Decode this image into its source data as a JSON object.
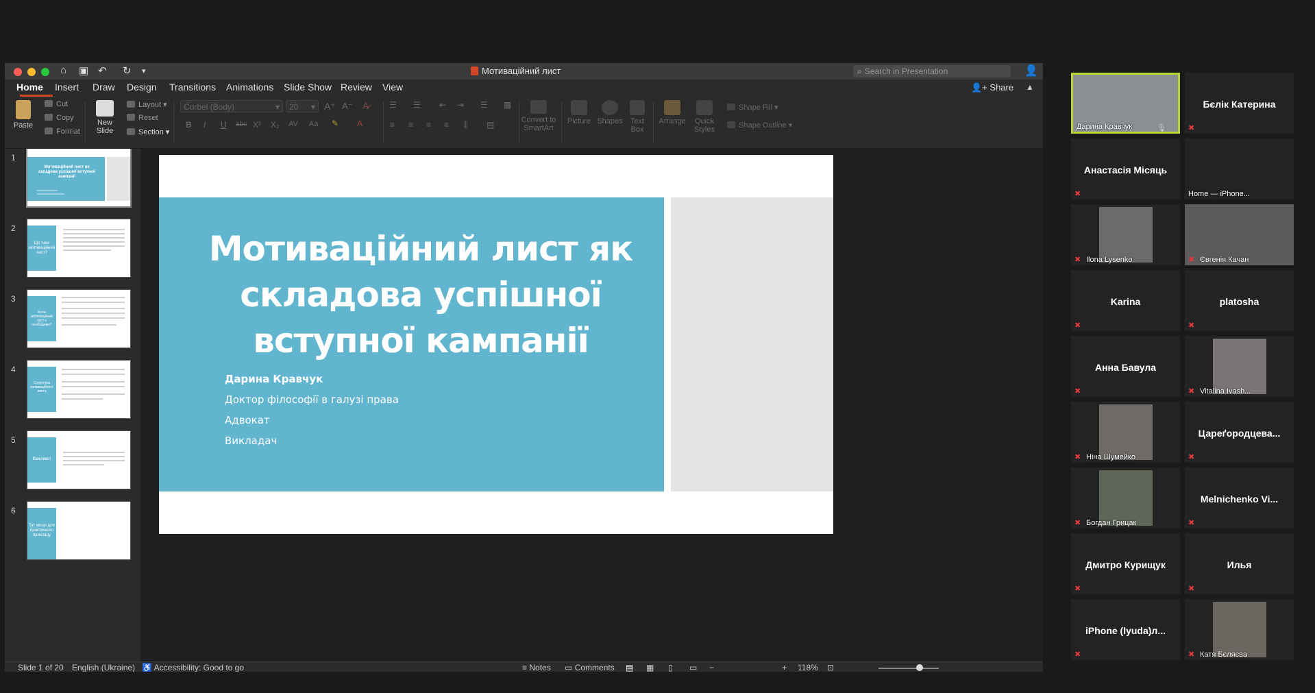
{
  "window": {
    "title": "Мотиваційний лист",
    "search_placeholder": "Search in Presentation",
    "share_label": "Share"
  },
  "tabs": [
    "Home",
    "Insert",
    "Draw",
    "Design",
    "Transitions",
    "Animations",
    "Slide Show",
    "Review",
    "View"
  ],
  "ribbon": {
    "paste": "Paste",
    "cut": "Cut",
    "copy": "Copy",
    "format": "Format",
    "new_slide": "New Slide",
    "layout": "Layout",
    "reset": "Reset",
    "section": "Section",
    "font_name": "Corbel (Body)",
    "font_size": "20",
    "convert_smartart": "Convert to SmartArt",
    "picture": "Picture",
    "shapes": "Shapes",
    "text_box": "Text Box",
    "arrange": "Arrange",
    "quick_styles": "Quick Styles",
    "shape_fill": "Shape Fill",
    "shape_outline": "Shape Outline"
  },
  "thumbnails": [
    {
      "num": "1",
      "title": "Мотиваційний лист як складова успішної вступної кампанії"
    },
    {
      "num": "2",
      "title": "Що таке мотиваційний лист?"
    },
    {
      "num": "3",
      "title": "Коли мотиваційний лист є необхідним?"
    },
    {
      "num": "4",
      "title": "Структура мотиваційного листа"
    },
    {
      "num": "5",
      "title": "Важливо!"
    },
    {
      "num": "6",
      "title": "Тут місце для практичного прикладу"
    }
  ],
  "slide": {
    "title": "Мотиваційний лист як складова успішної вступної кампанії",
    "author": "Дарина Кравчук",
    "degree": "Доктор філософії в галузі права",
    "role1": "Адвокат",
    "role2": "Викладач"
  },
  "status": {
    "slide_count": "Slide 1 of 20",
    "language": "English (Ukraine)",
    "accessibility": "Accessibility: Good to go",
    "notes": "Notes",
    "comments": "Comments",
    "zoom": "118%"
  },
  "participants": [
    {
      "name": "Дарина Кравчук",
      "video": true,
      "active": true
    },
    {
      "name": "Бєлік Катерина",
      "video": false
    },
    {
      "name": "Анастасія Місяць",
      "video": false
    },
    {
      "name": "Home — iPhone...",
      "video": false,
      "label_only": true
    },
    {
      "name": "Ilona Lysenko",
      "video": true
    },
    {
      "name": "Євгенія Качан",
      "video": true
    },
    {
      "name": "Karina",
      "video": false
    },
    {
      "name": "platosha",
      "video": false
    },
    {
      "name": "Анна Бавула",
      "video": false
    },
    {
      "name": "Vitalina Ivash...",
      "video": true
    },
    {
      "name": "Ніна Шумейко",
      "video": true
    },
    {
      "name": "Цареґородцева...",
      "video": false
    },
    {
      "name": "Богдан Грицак",
      "video": true
    },
    {
      "name": "Melnichenko  Vi...",
      "video": false
    },
    {
      "name": "Дмитро Курищук",
      "video": false
    },
    {
      "name": "Илья",
      "video": false
    },
    {
      "name": "iPhone  (lyuda)л...",
      "video": false
    },
    {
      "name": "Катя Бєляєва",
      "video": true
    }
  ]
}
